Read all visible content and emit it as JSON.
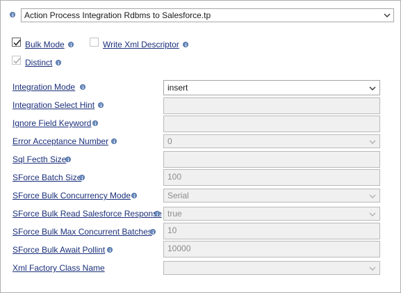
{
  "header": {
    "process_select": "Action Process Integration Rdbms to Salesforce.tp"
  },
  "options": {
    "bulk_mode": {
      "label": "Bulk Mode",
      "checked": true
    },
    "write_xml_descriptor": {
      "label": "Write Xml Descriptor",
      "checked": false
    },
    "distinct": {
      "label": "Distinct",
      "checked": true,
      "disabled": true
    }
  },
  "properties": [
    {
      "label": "Integration Mode",
      "value": "insert",
      "type": "select",
      "enabled": true
    },
    {
      "label": "Integration Select Hint",
      "value": "",
      "type": "text",
      "enabled": false
    },
    {
      "label": "Ignore Field Keyword",
      "value": "",
      "type": "text",
      "enabled": false
    },
    {
      "label": "Error Acceptance Number",
      "value": "0",
      "type": "select",
      "enabled": false
    },
    {
      "label": "Sql Fecth Size",
      "value": "",
      "type": "text",
      "enabled": false
    },
    {
      "label": "SForce Batch Size",
      "value": "100",
      "type": "text",
      "enabled": false
    },
    {
      "label": "SForce Bulk Concurrency Mode",
      "value": "Serial",
      "type": "select",
      "enabled": false
    },
    {
      "label": "SForce Bulk Read Salesforce Response",
      "value": "true",
      "type": "select",
      "enabled": false
    },
    {
      "label": "SForce Bulk Max Concurrent Batches",
      "value": "10",
      "type": "text",
      "enabled": false
    },
    {
      "label": "SForce Bulk Await Pollint",
      "value": "10000",
      "type": "text",
      "enabled": false
    },
    {
      "label": "Xml Factory Class Name",
      "value": "",
      "type": "select",
      "enabled": false
    }
  ],
  "colors": {
    "link": "#1a2f7a",
    "info_icon": "#6f8fc0",
    "disabled_field_bg": "#f0f0f0",
    "border": "#adadad"
  },
  "icons": {
    "info": "info-icon",
    "dropdown": "chevron-down-icon",
    "check": "checkmark-icon"
  }
}
